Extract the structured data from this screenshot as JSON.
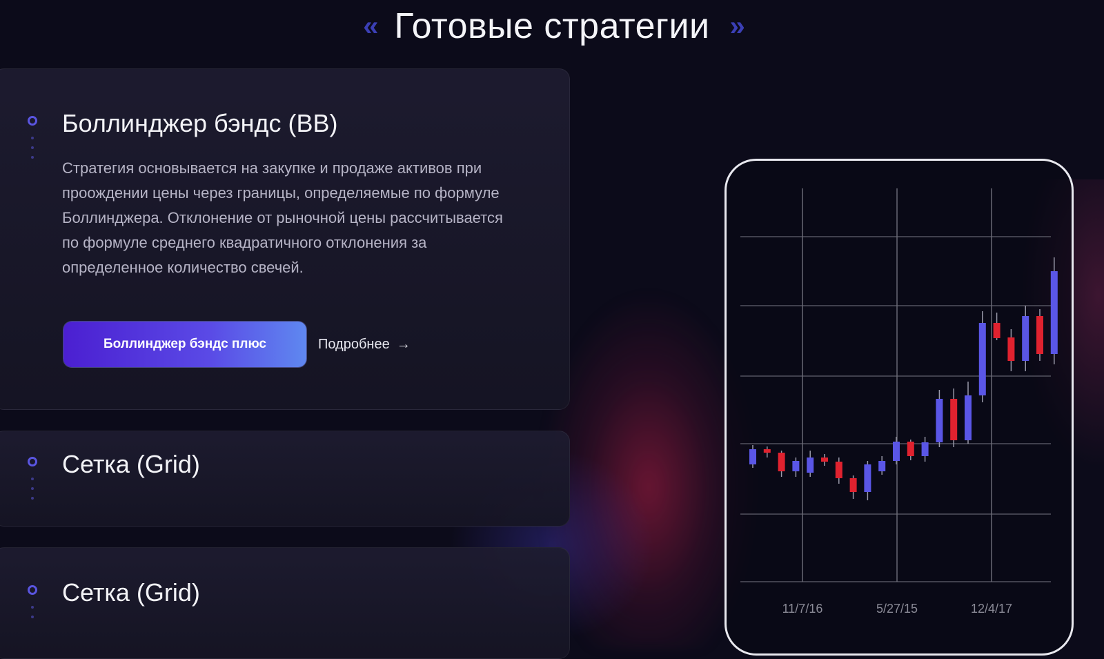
{
  "section": {
    "title": "Готовые стратегии",
    "left_chevrons": "«",
    "right_chevrons": "»"
  },
  "strategies": [
    {
      "title": "Боллинджер бэндс (BB)",
      "description": "Стратегия основывается на закупке и продаже активов при проождении цены через границы, определяемые по формуле Боллинджера. Отклонение от рыночной цены рассчитывается по формуле среднего квадратичного отклонения за определенное количество свечей.",
      "primary_button": "Боллинджер бэндс плюс",
      "more_link": "Подробнее",
      "more_arrow": "→"
    },
    {
      "title": "Сетка (Grid)"
    },
    {
      "title": "Сетка (Grid)"
    }
  ],
  "chart_data": {
    "type": "candlestick",
    "x_tick_labels": [
      "11/7/16",
      "5/27/15",
      "12/4/17"
    ],
    "colors": {
      "up": "#5a56e6",
      "down": "#e0222f",
      "grid": "#6e6e7a"
    },
    "candles": [
      {
        "o": 40,
        "c": 62,
        "h": 68,
        "l": 35
      },
      {
        "o": 62,
        "c": 57,
        "h": 66,
        "l": 50
      },
      {
        "o": 57,
        "c": 30,
        "h": 60,
        "l": 22
      },
      {
        "o": 30,
        "c": 45,
        "h": 50,
        "l": 22
      },
      {
        "o": 28,
        "c": 50,
        "h": 60,
        "l": 22
      },
      {
        "o": 50,
        "c": 44,
        "h": 55,
        "l": 38
      },
      {
        "o": 44,
        "c": 20,
        "h": 50,
        "l": 12
      },
      {
        "o": 20,
        "c": 0,
        "h": 24,
        "l": -10
      },
      {
        "o": 0,
        "c": 40,
        "h": 45,
        "l": -12
      },
      {
        "o": 30,
        "c": 45,
        "h": 52,
        "l": 25
      },
      {
        "o": 45,
        "c": 73,
        "h": 80,
        "l": 40
      },
      {
        "o": 73,
        "c": 52,
        "h": 76,
        "l": 46
      },
      {
        "o": 52,
        "c": 72,
        "h": 80,
        "l": 44
      },
      {
        "o": 72,
        "c": 135,
        "h": 148,
        "l": 65
      },
      {
        "o": 135,
        "c": 75,
        "h": 150,
        "l": 65
      },
      {
        "o": 75,
        "c": 140,
        "h": 160,
        "l": 70
      },
      {
        "o": 140,
        "c": 245,
        "h": 262,
        "l": 130
      },
      {
        "o": 245,
        "c": 223,
        "h": 260,
        "l": 220
      },
      {
        "o": 224,
        "c": 190,
        "h": 236,
        "l": 175
      },
      {
        "o": 190,
        "c": 255,
        "h": 270,
        "l": 175
      },
      {
        "o": 255,
        "c": 200,
        "h": 265,
        "l": 190
      },
      {
        "o": 200,
        "c": 320,
        "h": 340,
        "l": 185
      }
    ]
  }
}
